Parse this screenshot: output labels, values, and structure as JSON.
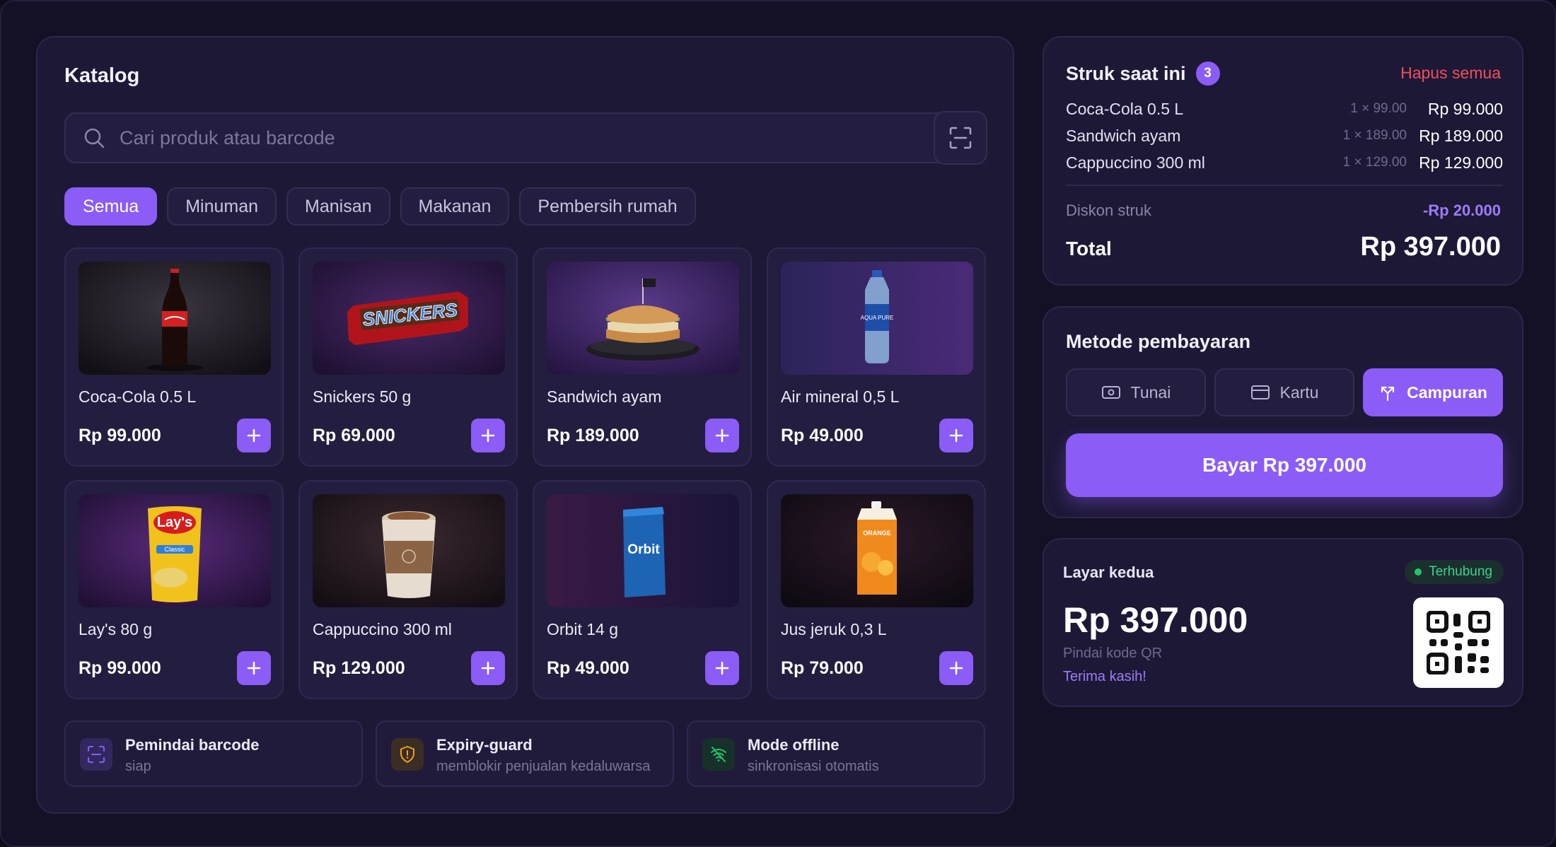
{
  "catalog": {
    "title": "Katalog",
    "search_placeholder": "Cari produk atau barcode",
    "tabs": [
      {
        "label": "Semua",
        "active": true
      },
      {
        "label": "Minuman"
      },
      {
        "label": "Manisan"
      },
      {
        "label": "Makanan"
      },
      {
        "label": "Pembersih rumah"
      }
    ],
    "products": [
      {
        "name": "Coca-Cola 0.5 L",
        "price": "Rp 99.000",
        "image": "cola-bottle"
      },
      {
        "name": "Snickers 50 g",
        "price": "Rp 69.000",
        "image": "snickers-bar"
      },
      {
        "name": "Sandwich ayam",
        "price": "Rp 189.000",
        "image": "chicken-sandwich"
      },
      {
        "name": "Air mineral 0,5 L",
        "price": "Rp 49.000",
        "image": "water-bottle"
      },
      {
        "name": "Lay's 80 g",
        "price": "Rp 99.000",
        "image": "chips-bag"
      },
      {
        "name": "Cappuccino 300 ml",
        "price": "Rp 129.000",
        "image": "coffee-cup"
      },
      {
        "name": "Orbit 14 g",
        "price": "Rp 49.000",
        "image": "gum-pack"
      },
      {
        "name": "Jus jeruk 0,3 L",
        "price": "Rp 79.000",
        "image": "juice-carton"
      }
    ],
    "status": [
      {
        "title": "Pemindai barcode",
        "sub": "siap",
        "icon": "barcode-scan-icon"
      },
      {
        "title": "Expiry-guard",
        "sub": "memblokir penjualan kedaluwarsa",
        "icon": "shield-icon"
      },
      {
        "title": "Mode offline",
        "sub": "sinkronisasi otomatis",
        "icon": "wifi-off-icon"
      }
    ],
    "image_labels": {
      "snickers": "SNICKERS",
      "lays": "Lay's",
      "lays_variant": "Classic",
      "orbit": "Orbit",
      "water": "AQUA PURE",
      "juice": "ORANGE"
    }
  },
  "receipt": {
    "title": "Struk saat ini",
    "count": "3",
    "clear_label": "Hapus semua",
    "items": [
      {
        "name": "Coca-Cola 0.5 L",
        "qty": "1 × 99.00",
        "sum": "Rp 99.000"
      },
      {
        "name": "Sandwich ayam",
        "qty": "1 × 189.00",
        "sum": "Rp 189.000"
      },
      {
        "name": "Cappuccino 300 ml",
        "qty": "1 × 129.00",
        "sum": "Rp 129.000"
      }
    ],
    "discount_label": "Diskon struk",
    "discount_value": "-Rp 20.000",
    "total_label": "Total",
    "total_value": "Rp 397.000"
  },
  "payment": {
    "title": "Metode pembayaran",
    "options": [
      {
        "label": "Tunai",
        "icon": "cash-icon"
      },
      {
        "label": "Kartu",
        "icon": "card-icon"
      },
      {
        "label": "Campuran",
        "icon": "split-icon",
        "active": true
      }
    ],
    "pay_label": "Bayar Rp 397.000"
  },
  "second_screen": {
    "title": "Layar kedua",
    "status": "Terhubung",
    "amount": "Rp 397.000",
    "hint": "Pindai kode QR",
    "thanks": "Terima kasih!"
  },
  "colors": {
    "accent": "#8b5cf6",
    "danger": "#ef4f5a",
    "success": "#22c56d",
    "background": "#141127",
    "panel": "#1d1836"
  }
}
